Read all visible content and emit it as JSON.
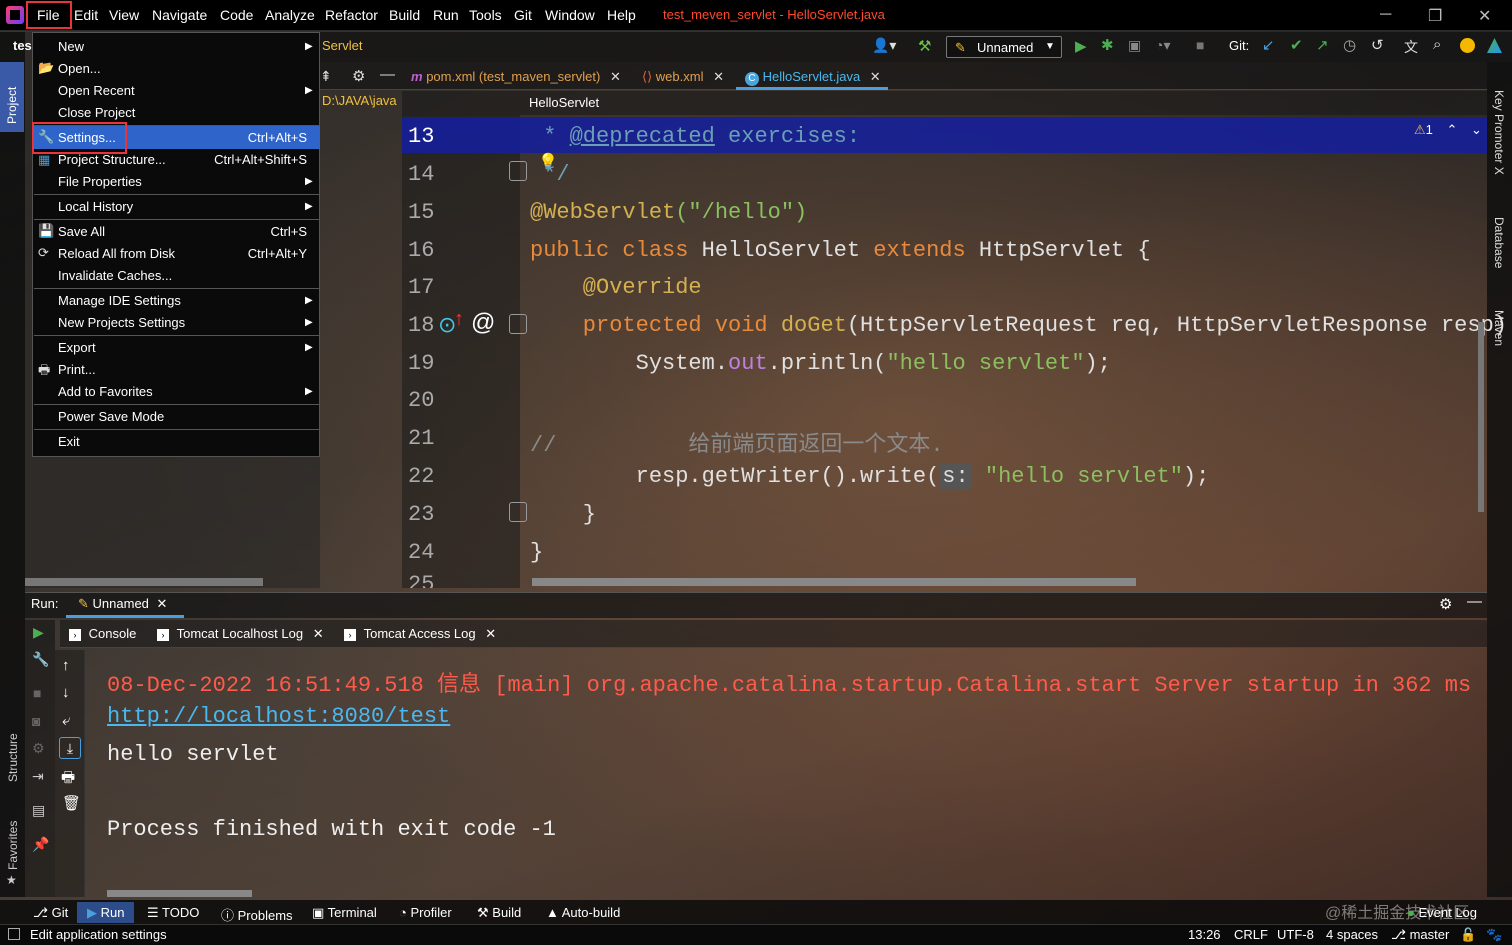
{
  "window": {
    "title": "test_meven_servlet - HelloServlet.java",
    "controls": [
      "─",
      "❐",
      "✕"
    ]
  },
  "menubar": {
    "items": [
      "File",
      "Edit",
      "View",
      "Navigate",
      "Code",
      "Analyze",
      "Refactor",
      "Build",
      "Run",
      "Tools",
      "Git",
      "Window",
      "Help"
    ]
  },
  "toolbar": {
    "nav_crumb": "Servlet",
    "run_config": "Unnamed",
    "git_label": "Git:"
  },
  "project": {
    "name_prefix": "tes",
    "path_prefix": "D:\\JAVA\\java",
    "tab_label": "Project"
  },
  "tabs": [
    {
      "label": "pom.xml (test_maven_servlet)",
      "icon": "maven-icon"
    },
    {
      "label": "web.xml",
      "icon": "xml-icon"
    },
    {
      "label": "HelloServlet.java",
      "icon": "class-icon",
      "active": true
    }
  ],
  "breadcrumb": "HelloServlet",
  "editor": {
    "inspection_count": "1",
    "lines": [
      {
        "num": "13"
      },
      {
        "num": "14"
      },
      {
        "num": "15"
      },
      {
        "num": "16"
      },
      {
        "num": "17"
      },
      {
        "num": "18"
      },
      {
        "num": "19"
      },
      {
        "num": "20"
      },
      {
        "num": "21"
      },
      {
        "num": "22"
      },
      {
        "num": "23"
      },
      {
        "num": "24"
      },
      {
        "num": "25"
      }
    ],
    "code": {
      "l13_star": " * ",
      "l13_tag": "@deprecated",
      "l13_text": " exercises:",
      "l14": " */",
      "l15_ann": "@WebServlet",
      "l15_str": "(\"/hello\")",
      "l16_kw1": "public class ",
      "l16_name": "HelloServlet ",
      "l16_kw2": "extends ",
      "l16_parent": "HttpServlet {",
      "l17": "    @Override",
      "l18_kw": "    protected void ",
      "l18_method": "doGet",
      "l18_params": "(HttpServletRequest req, HttpServletResponse resp)",
      "l19_a": "        System.",
      "l19_out": "out",
      "l19_b": ".println(",
      "l19_str": "\"hello servlet\"",
      "l19_c": ");",
      "l21_cmt": "//          给前端页面返回一个文本.",
      "l22_a": "        resp.getWriter().write(",
      "l22_hint": "s:",
      "l22_str": " \"hello servlet\"",
      "l22_c": ");",
      "l23": "    }",
      "l24": "}"
    }
  },
  "filemenu": {
    "items": [
      {
        "label": "New",
        "submenu": true
      },
      {
        "label": "Open...",
        "icon": "folder-open-icon"
      },
      {
        "label": "Open Recent",
        "submenu": true
      },
      {
        "label": "Close Project"
      },
      {
        "label": "Settings...",
        "shortcut": "Ctrl+Alt+S",
        "icon": "wrench-icon",
        "selected": true
      },
      {
        "label": "Project Structure...",
        "shortcut": "Ctrl+Alt+Shift+S",
        "icon": "project-structure-icon"
      },
      {
        "label": "File Properties",
        "submenu": true
      },
      {
        "label": "Local History",
        "submenu": true
      },
      {
        "label": "Save All",
        "shortcut": "Ctrl+S",
        "icon": "save-icon"
      },
      {
        "label": "Reload All from Disk",
        "shortcut": "Ctrl+Alt+Y",
        "icon": "reload-icon"
      },
      {
        "label": "Invalidate Caches..."
      },
      {
        "label": "Manage IDE Settings",
        "submenu": true
      },
      {
        "label": "New Projects Settings",
        "submenu": true
      },
      {
        "label": "Export",
        "submenu": true
      },
      {
        "label": "Print...",
        "icon": "print-icon"
      },
      {
        "label": "Add to Favorites",
        "submenu": true
      },
      {
        "label": "Power Save Mode"
      },
      {
        "label": "Exit"
      }
    ]
  },
  "run": {
    "label": "Run:",
    "config_tab": "Unnamed",
    "tabs": [
      {
        "label": "Console"
      },
      {
        "label": "Tomcat Localhost Log"
      },
      {
        "label": "Tomcat Access Log"
      }
    ],
    "console": {
      "line1": "08-Dec-2022 16:51:49.518 信息 [main] org.apache.catalina.startup.Catalina.start Server startup in 362 ms",
      "line2": "http://localhost:8080/test",
      "line3": "hello servlet",
      "line4": "Process finished with exit code -1"
    }
  },
  "toolwindows": [
    "Git",
    "Run",
    "TODO",
    "Problems",
    "Terminal",
    "Profiler",
    "Build",
    "Auto-build",
    "Event Log"
  ],
  "side_tabs": {
    "left_structure": "Structure",
    "left_favorites": "Favorites",
    "right_key": "Key Promoter X",
    "right_db": "Database",
    "right_maven": "Maven"
  },
  "status": {
    "message": "Edit application settings",
    "position": "13:26",
    "line_sep": "CRLF",
    "encoding": "UTF-8",
    "indent": "4 spaces",
    "branch": "master"
  },
  "watermark": "@稀土掘金技术社区",
  "colors": {
    "accent": "#2f65ca",
    "highlight_box": "#e8353a",
    "title": "#ff4a2e"
  }
}
